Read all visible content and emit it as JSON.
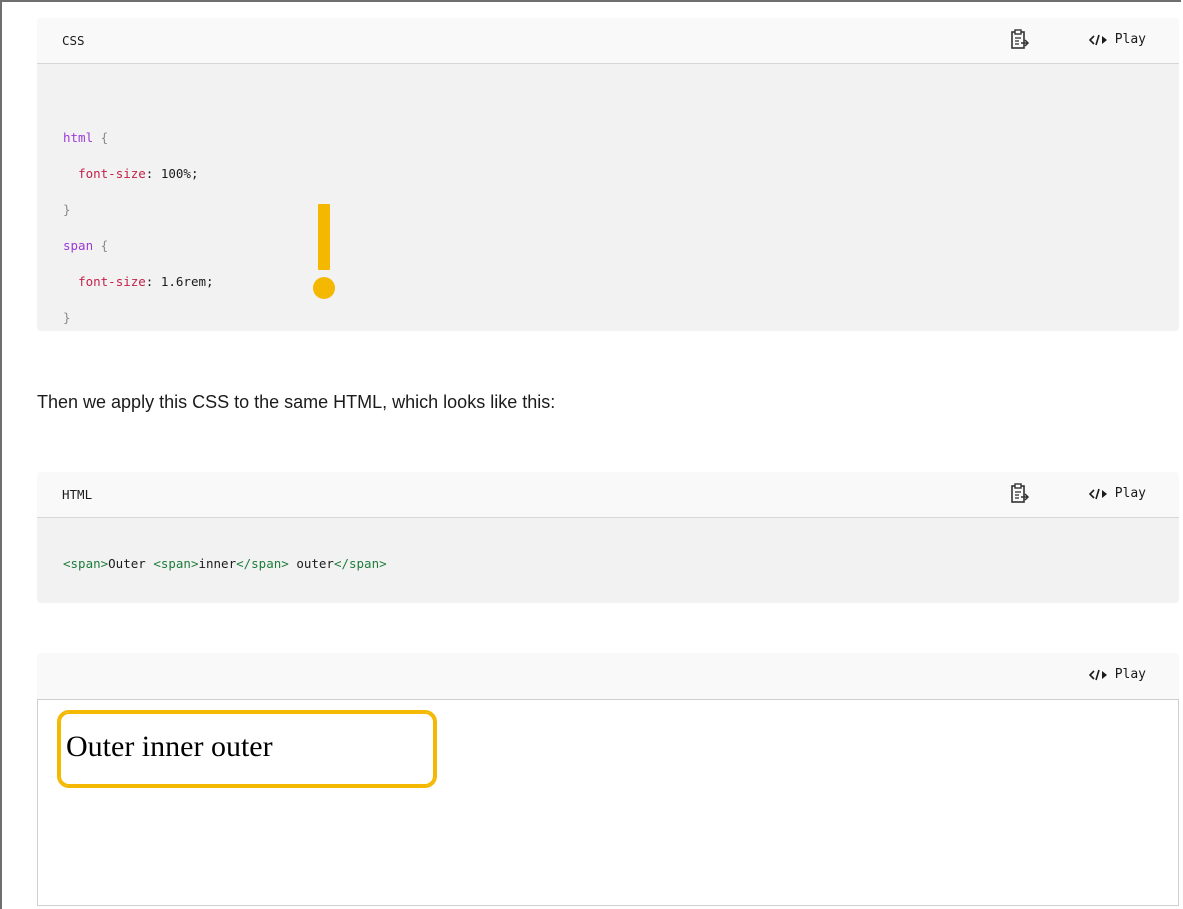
{
  "css_block": {
    "lang": "CSS",
    "play_label": "Play",
    "lines": [
      {
        "sel": "html",
        "rest": " {"
      },
      {
        "prop": "font-size",
        "rest": ": 100%;"
      },
      {
        "punc": "}"
      },
      {
        "sel": "span",
        "rest": " {"
      },
      {
        "prop": "font-size",
        "rest": ": 1.6rem;"
      },
      {
        "punc": "}"
      }
    ]
  },
  "prose": "Then we apply this CSS to the same HTML, which looks like this:",
  "html_block": {
    "lang": "HTML",
    "play_label": "Play",
    "code": {
      "t1": "<span>",
      "t2": "Outer ",
      "t3": "<span>",
      "t4": "inner",
      "t5": "</span>",
      "t6": " outer",
      "t7": "</span>"
    }
  },
  "result_block": {
    "play_label": "Play",
    "output_text": "Outer inner outer"
  },
  "colors": {
    "accent": "#f4b800",
    "selector": "#9b3bd8",
    "property": "#c3224a",
    "tag": "#1e7c3a"
  },
  "icons": {
    "copy": "clipboard-copy-icon",
    "play": "code-play-icon"
  }
}
